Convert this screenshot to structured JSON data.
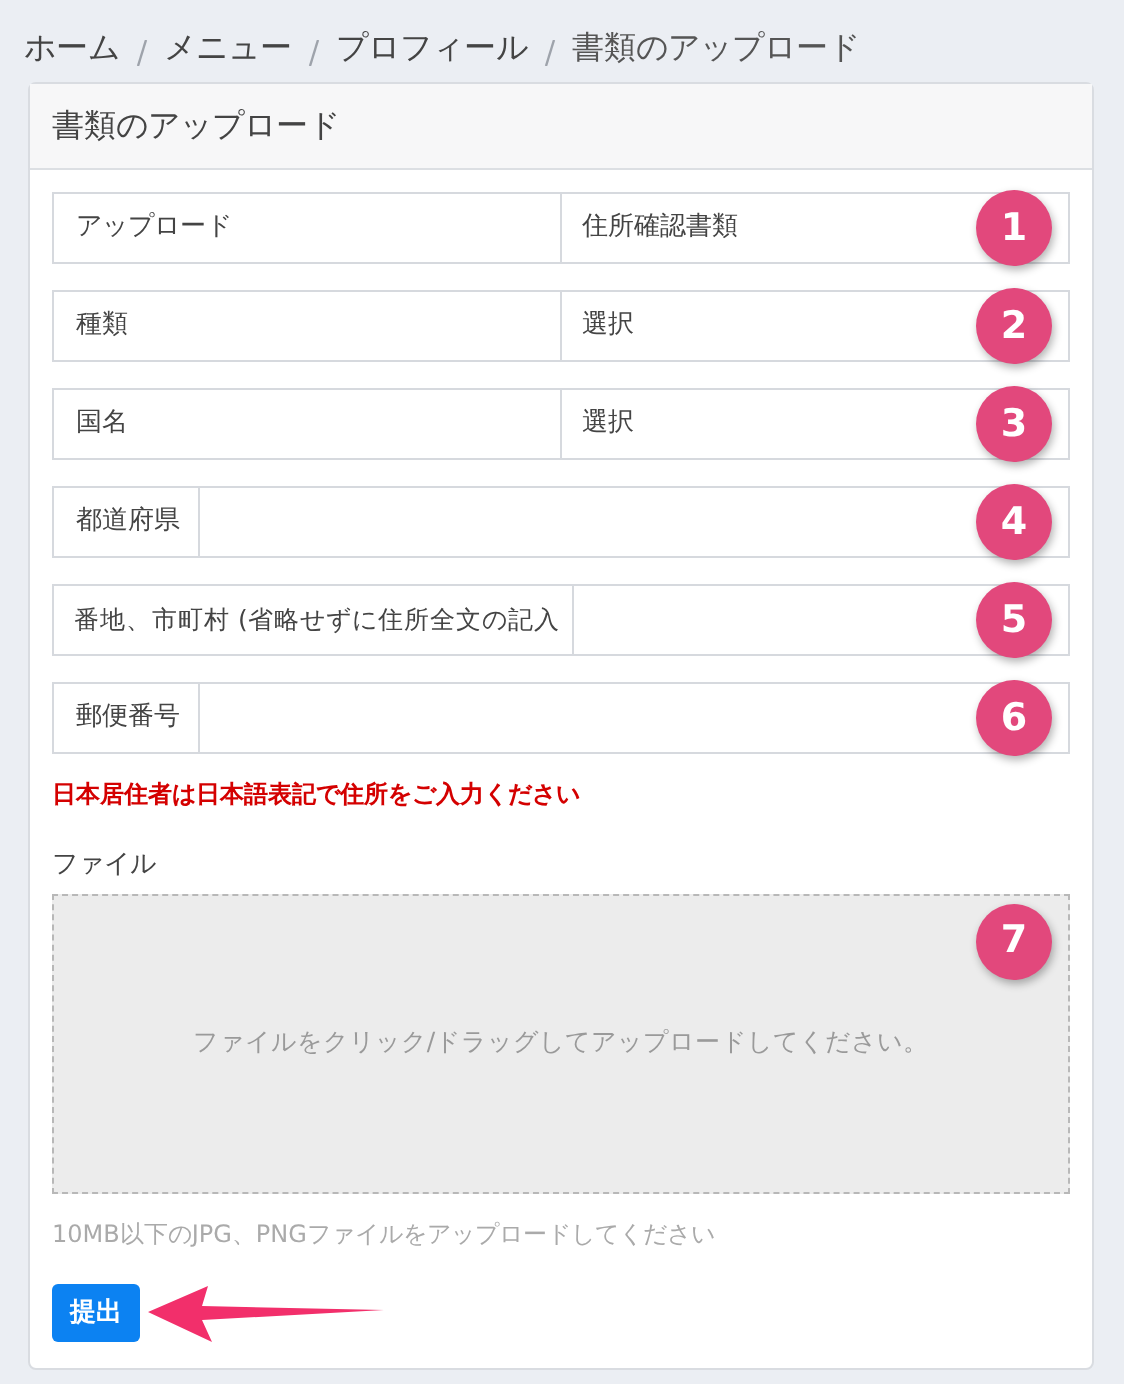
{
  "breadcrumb": [
    {
      "label": "ホーム",
      "selected": false
    },
    {
      "label": "メニュー",
      "selected": false
    },
    {
      "label": "プロフィール",
      "selected": false
    },
    {
      "label": "書類のアップロード",
      "selected": true
    }
  ],
  "card": {
    "title": "書類のアップロード",
    "rows": [
      {
        "kind": "select",
        "label": "アップロード",
        "value": "住所確認書類",
        "marker": "1"
      },
      {
        "kind": "select",
        "label": "種類",
        "value": "選択",
        "marker": "2"
      },
      {
        "kind": "select",
        "label": "国名",
        "value": "選択",
        "marker": "3"
      },
      {
        "kind": "input",
        "label": "都道府県",
        "marker": "4"
      },
      {
        "kind": "wide-input",
        "label": "番地、市町村 (省略せずに住所全文の記入",
        "marker": "5"
      },
      {
        "kind": "input",
        "label": "郵便番号",
        "marker": "6"
      }
    ],
    "warning": "日本居住者は日本語表記で住所をご入力ください",
    "file_label": "ファイル",
    "dropzone": {
      "text": "ファイルをクリック/ドラッグしてアップロードしてください。",
      "marker": "7"
    },
    "hint": "10MB以下のJPG、PNGファイルをアップロードしてください",
    "submit": "提出"
  }
}
